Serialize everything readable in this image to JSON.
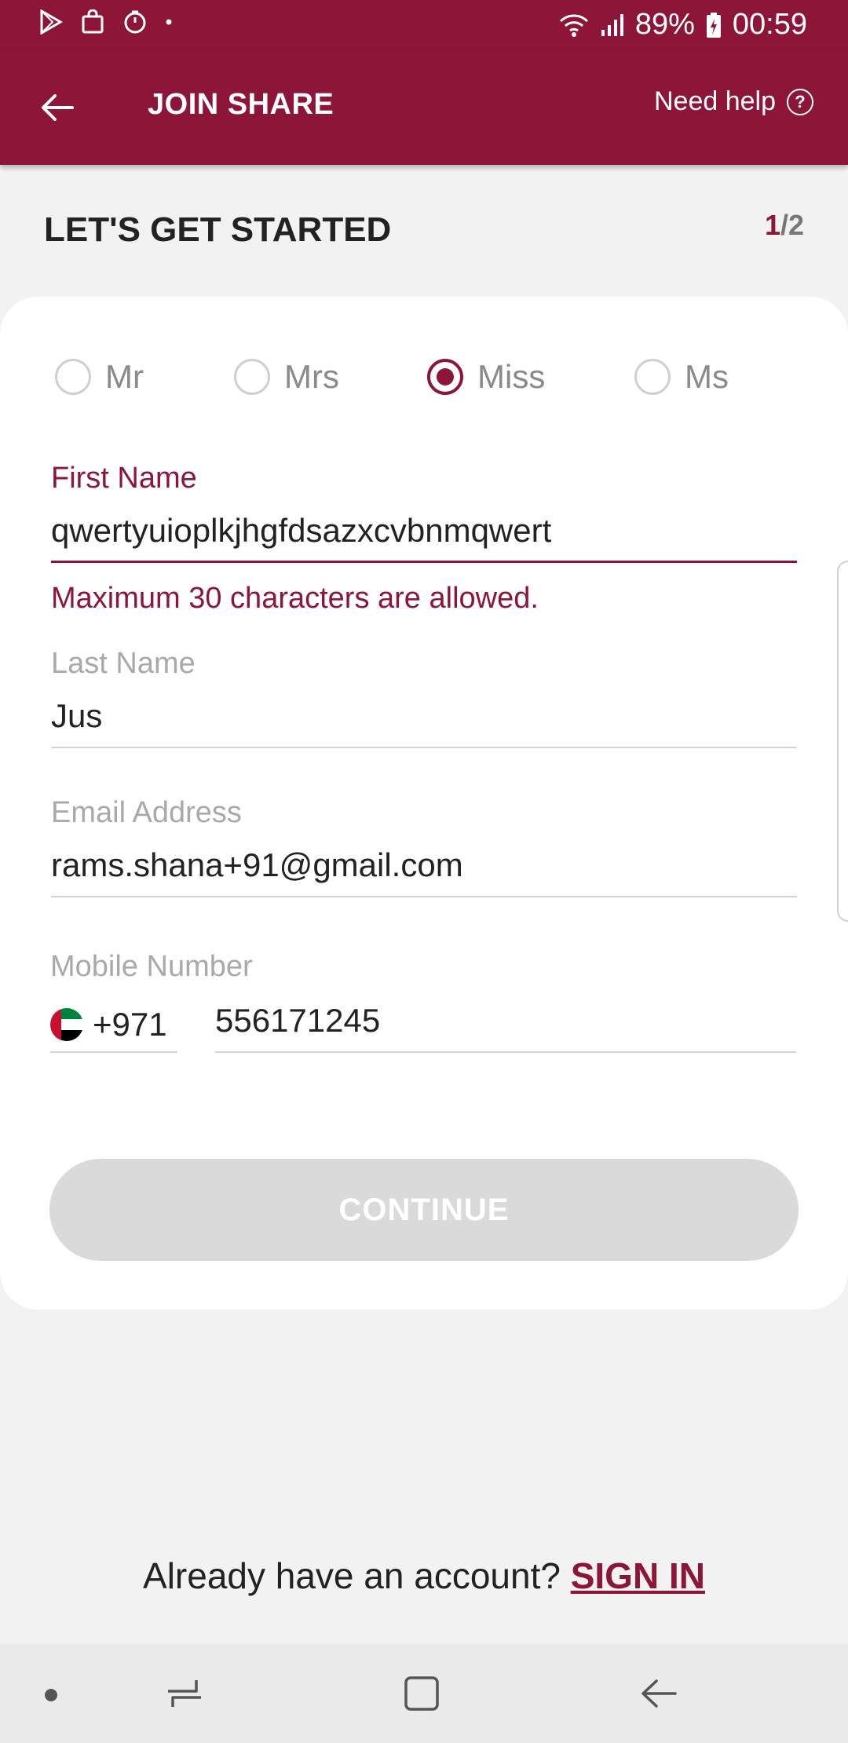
{
  "status_bar": {
    "battery": "89%",
    "time": "00:59",
    "left_icons": [
      "play-store-icon",
      "shopping-bag-icon",
      "timer-icon",
      "dot-icon"
    ],
    "right_icons": [
      "wifi-icon",
      "signal-icon",
      "battery-icon"
    ]
  },
  "app_bar": {
    "title": "JOIN SHARE",
    "help_label": "Need help",
    "help_icon": "?",
    "back_icon": "arrow-left-icon"
  },
  "page": {
    "heading": "LET'S GET STARTED",
    "step_current": "1",
    "step_total": "/2"
  },
  "form": {
    "titles": [
      {
        "label": "Mr",
        "checked": false
      },
      {
        "label": "Mrs",
        "checked": false
      },
      {
        "label": "Miss",
        "checked": true
      },
      {
        "label": "Ms",
        "checked": false
      }
    ],
    "first_name": {
      "label": "First Name",
      "value": "qwertyuioplkjhgfdsazxcvbnmqwert",
      "error": "Maximum 30 characters are allowed."
    },
    "last_name": {
      "label": "Last Name",
      "value": "Jus"
    },
    "email": {
      "label": "Email Address",
      "value": "rams.shana+91@gmail.com"
    },
    "mobile": {
      "label": "Mobile Number",
      "country_code": "+971",
      "number": "556171245"
    },
    "continue_label": "CONTINUE"
  },
  "footer": {
    "prompt": "Already have an account?",
    "signin_label": "SIGN IN"
  },
  "colors": {
    "brand": "#8c1538",
    "background": "#f2f2f2",
    "button_disabled": "#dadada"
  }
}
